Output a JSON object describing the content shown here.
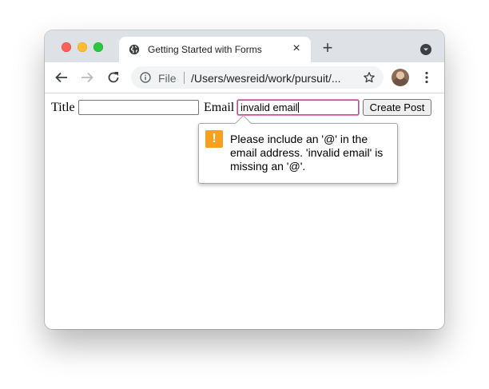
{
  "tab": {
    "title": "Getting Started with Forms",
    "close_glyph": "×",
    "new_tab_glyph": "+"
  },
  "toolbar": {
    "omnibox_scheme": "File",
    "omnibox_url": "/Users/wesreid/work/pursuit/..."
  },
  "form": {
    "title_label": "Title",
    "title_value": "",
    "email_label": "Email",
    "email_value": "invalid email",
    "submit_label": "Create Post"
  },
  "validation": {
    "icon_glyph": "!",
    "message": "Please include an '@' in the email address. 'invalid email' is missing an '@'."
  },
  "colors": {
    "tabstrip": "#dee1e6",
    "warning": "#f7a01d",
    "focus_ring": "#e57cc4"
  }
}
